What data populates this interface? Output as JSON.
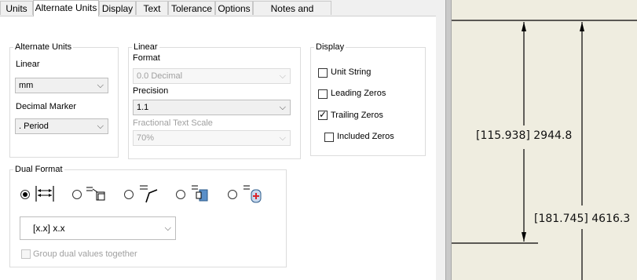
{
  "tabs": [
    "Units",
    "Alternate Units",
    "Display",
    "Text",
    "Tolerance",
    "Options",
    "Notes and Leaders"
  ],
  "active_tab": "Alternate Units",
  "alternate_units": {
    "title": "Alternate Units",
    "linear_label": "Linear",
    "linear_value": "mm",
    "decimal_marker_label": "Decimal Marker",
    "decimal_marker_value": ". Period"
  },
  "linear": {
    "title": "Linear",
    "format_label": "Format",
    "format_value": "0.0 Decimal",
    "precision_label": "Precision",
    "precision_value": "1.1",
    "fractional_scale_label": "Fractional Text Scale",
    "fractional_scale_value": "70%"
  },
  "display": {
    "title": "Display",
    "options": [
      {
        "label": "Unit String",
        "checked": false
      },
      {
        "label": "Leading Zeros",
        "checked": false
      },
      {
        "label": "Trailing Zeros",
        "checked": true
      },
      {
        "label": "Included Zeros",
        "checked": false
      }
    ]
  },
  "dual_format": {
    "title": "Dual Format",
    "format_options": [
      "dual-stacked-arrows-icon",
      "dual-inline-box-icon",
      "dual-leader-bent-icon",
      "dual-flag-block-icon",
      "dual-symbol-plus-icon"
    ],
    "selected_index": 0,
    "format_value": "[x.x] x.x",
    "group_label": "Group dual values together"
  },
  "drawing": {
    "dimension_1": "[115.938] 2944.8",
    "dimension_2": "[181.745] 4616.3"
  },
  "colors": {
    "canvas": "#efede0",
    "accent_red": "#d9242b",
    "icon_blue": "#5a8fc8"
  }
}
